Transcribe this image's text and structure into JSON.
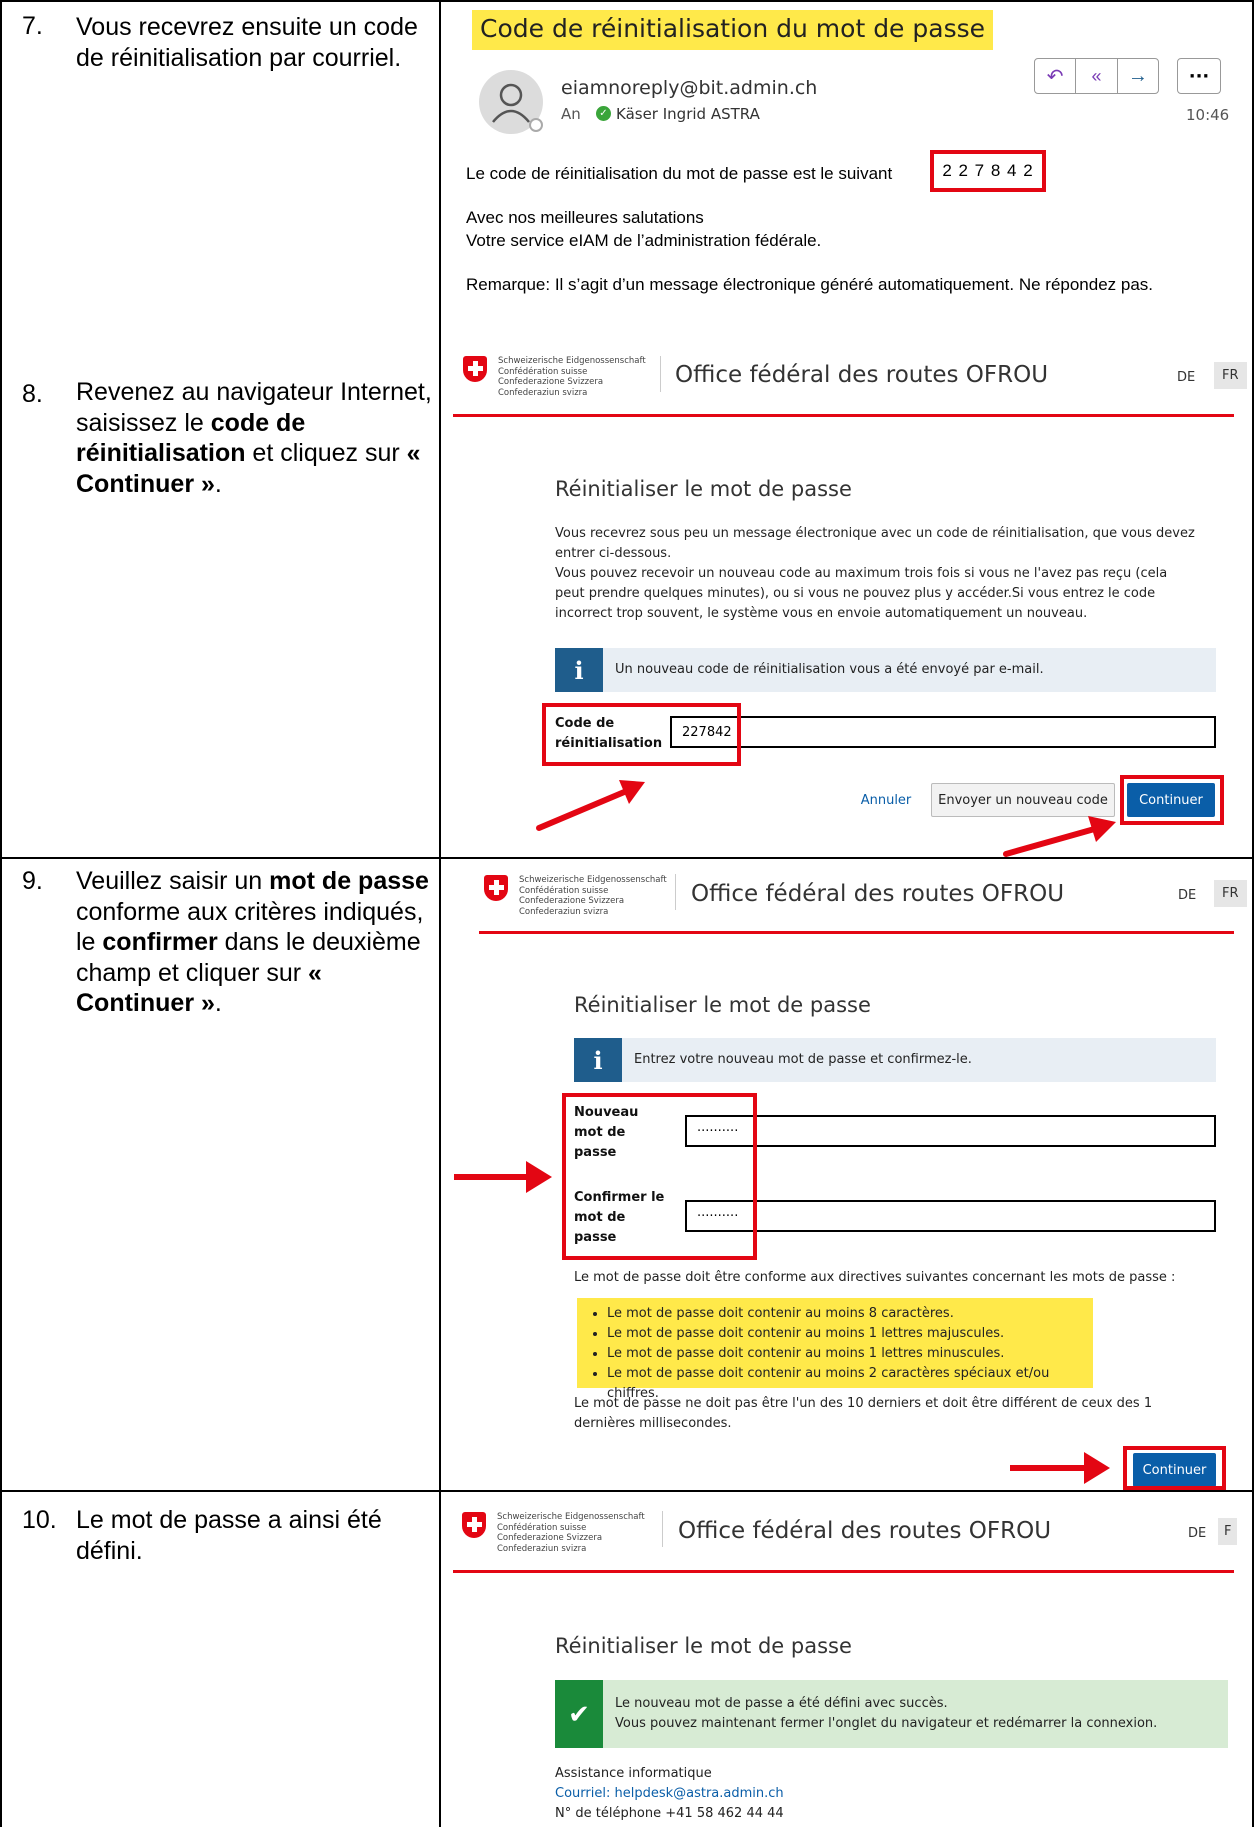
{
  "steps": [
    {
      "num": "7.",
      "text_html": "Vous recevrez ensuite un code de réinitialisation par courriel."
    },
    {
      "num": "8.",
      "pre": "Revenez au navigateur Internet, saisissez le ",
      "b1": "code de réinitialisation",
      "mid": " et cliquez sur ",
      "b2": "« Continuer »",
      "post": "."
    },
    {
      "num": "9.",
      "pre": "Veuillez saisir un ",
      "b1": "mot de passe",
      "mid": " conforme aux critères indiqués, le ",
      "b2": "confirmer",
      "mid2": " dans le deuxième champ et cliquer sur ",
      "b3": "« Continuer »",
      "post": "."
    },
    {
      "num": "10.",
      "text": "Le mot de passe a ainsi été défini."
    }
  ],
  "email": {
    "subject": "Code de réinitialisation du mot de passe",
    "sender": "eiamnoreply@bit.admin.ch",
    "to_label": "An",
    "recipient": "Käser Ingrid ASTRA",
    "time": "10:46",
    "body_line1": "Le code de réinitialisation du mot de passe est le suivant",
    "code": "2 2 7 8 4 2",
    "greeting1": "Avec nos meilleures salutations",
    "greeting2": "Votre service eIAM de l’administration fédérale.",
    "remark": "Remarque: Il s’agit d’un message électronique généré automatiquement. Ne répondez pas.",
    "more_label": "···"
  },
  "header": {
    "crest_lines": [
      "Schweizerische Eidgenossenschaft",
      "Confédération suisse",
      "Confederazione Svizzera",
      "Confederaziun svizra"
    ],
    "office": "Office fédéral des routes OFROU",
    "lang_de": "DE",
    "lang_fr": "FR",
    "lang_fr_cut": "F"
  },
  "screen8": {
    "title": "Réinitialiser le mot de passe",
    "p1": "Vous recevrez sous peu un message électronique avec un code de réinitialisation, que vous devez entrer ci-dessous.",
    "p2": "Vous pouvez recevoir un nouveau code au maximum trois fois si vous ne l'avez pas reçu (cela peut prendre quelques minutes), ou si vous ne pouvez plus y accéder.Si vous entrez le code incorrect trop souvent, le système vous en envoie automatiquement un nouveau.",
    "info": "Un nouveau code de réinitialisation vous a été envoyé par e-mail.",
    "code_label_1": "Code de",
    "code_label_2": "réinitialisation",
    "code_value": "227842",
    "cancel": "Annuler",
    "resend": "Envoyer un nouveau code",
    "continue": "Continuer"
  },
  "screen9": {
    "title": "Réinitialiser le mot de passe",
    "info": "Entrez votre nouveau mot de passe et confirmez-le.",
    "new_pw_label": [
      "Nouveau",
      "mot de",
      "passe"
    ],
    "confirm_pw_label": [
      "Confirmer le",
      "mot de",
      "passe"
    ],
    "pw_value": "··········",
    "rules_intro": "Le mot de passe doit être conforme aux directives suivantes concernant les mots de passe :",
    "rules": [
      "Le mot de passe doit contenir au moins 8 caractères.",
      "Le mot de passe doit contenir au moins 1 lettres majuscules.",
      "Le mot de passe doit contenir au moins 1 lettres minuscules.",
      "Le mot de passe doit contenir au moins 2 caractères spéciaux et/ou chiffres."
    ],
    "history_rule": "Le mot de passe ne doit pas être l'un des 10 derniers et doit être différent de ceux des 1 dernières millisecondes.",
    "continue": "Continuer"
  },
  "screen10": {
    "title": "Réinitialiser le mot de passe",
    "success1": "Le nouveau mot de passe a été défini avec succès.",
    "success2": "Vous pouvez maintenant fermer l'onglet du navigateur et redémarrer la connexion.",
    "support_title": "Assistance informatique",
    "support_email": "Courriel: helpdesk@astra.admin.ch",
    "support_phone": "N° de téléphone  +41 58 462 44 44"
  },
  "colors": {
    "red": "#e30613",
    "blue": "#0a5ea8",
    "highlight": "#ffe94a",
    "success": "#1a8a3a"
  }
}
